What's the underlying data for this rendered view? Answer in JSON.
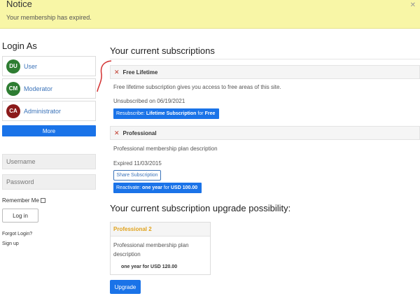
{
  "notice": {
    "title": "Notice",
    "text": "Your membership has expired."
  },
  "sidebar": {
    "title": "Login As",
    "users": [
      {
        "initials": "DU",
        "label": "User",
        "color": "#2e7d32"
      },
      {
        "initials": "CM",
        "label": "Moderator",
        "color": "#2e7d32"
      },
      {
        "initials": "CA",
        "label": "Administrator",
        "color": "#8b1a1a"
      }
    ],
    "more_label": "More",
    "username_placeholder": "Username",
    "password_placeholder": "Password",
    "remember_label": "Remember Me",
    "login_label": "Log in",
    "forgot_label": "Forgot Login?",
    "signup_label": "Sign up"
  },
  "main": {
    "subscriptions_heading": "Your current subscriptions",
    "subscriptions": [
      {
        "title": "Free Lifetime",
        "description": "Free lifetime subscription gives you access to free areas of this site.",
        "status": "Unsubscribed on 06/19/2021",
        "action_prefix": "Resubscribe:",
        "action_plan": "Lifetime Subscription",
        "action_mid": "for",
        "action_price": "Free"
      },
      {
        "title": "Professional",
        "description": "Professional membership plan description",
        "status": "Expired 11/03/2015",
        "share_label": "Share Subscription",
        "action_prefix": "Reactivate:",
        "action_plan": "one year",
        "action_mid": "for",
        "action_price": "USD 100.00"
      }
    ],
    "upgrade_heading": "Your current subscription upgrade possibility:",
    "upgrade_plan": {
      "title": "Professional 2",
      "description": "Professional membership plan description",
      "price": "one year for USD 120.00"
    },
    "upgrade_button": "Upgrade"
  },
  "colors": {
    "accent": "#1a73e8",
    "notice_bg": "#f8f6a6",
    "plan_title": "#e0a21b",
    "annotation": "#d32f2f"
  }
}
